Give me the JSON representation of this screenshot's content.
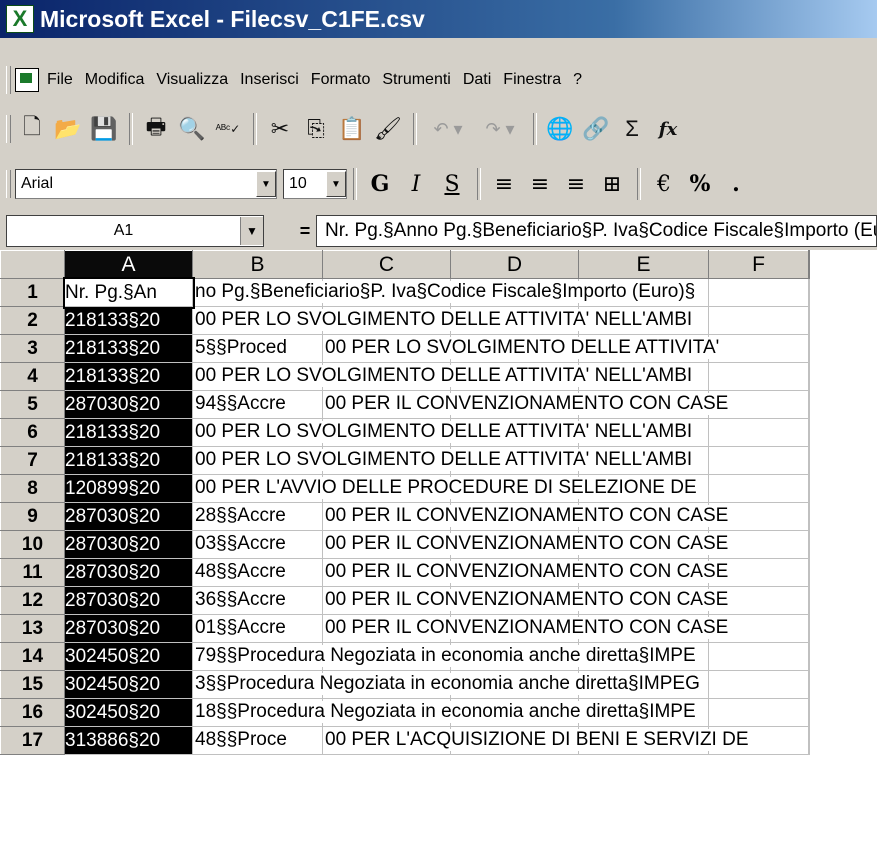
{
  "window": {
    "title": "Microsoft Excel - Filecsv_C1FE.csv",
    "app_icon": "excel-icon"
  },
  "menu": [
    {
      "label": "File"
    },
    {
      "label": "Modifica"
    },
    {
      "label": "Visualizza"
    },
    {
      "label": "Inserisci"
    },
    {
      "label": "Formato"
    },
    {
      "label": "Strumenti"
    },
    {
      "label": "Dati"
    },
    {
      "label": "Finestra"
    },
    {
      "label": "?"
    }
  ],
  "toolbar": {
    "new": "🗋",
    "open": "📂",
    "save": "💾",
    "print": "🖶",
    "preview": "🔍",
    "spell": "ᴬᴮᶜ✓",
    "cut": "✂",
    "copy": "⎘",
    "paste": "📋",
    "format_painter": "🖌",
    "undo": "↶ ▾",
    "redo": "↷ ▾",
    "web": "🌐",
    "hyperlink": "🔗",
    "autosum": "Σ",
    "function": "fx"
  },
  "format": {
    "font": "Arial",
    "size": "10",
    "bold": "G",
    "italic": "I",
    "underline": "S",
    "align_left": "≡",
    "align_center": "≡",
    "align_right": "≡",
    "merge": "⊞",
    "currency": "€",
    "percent": "%",
    "thousands": "."
  },
  "formula_bar": {
    "name_box": "A1",
    "equals": "=",
    "content": "Nr. Pg.§Anno Pg.§Beneficiario§P. Iva§Codice Fiscale§Importo (Euro)§"
  },
  "columns": [
    "A",
    "B",
    "C",
    "D",
    "E",
    "F"
  ],
  "rows": [
    {
      "num": "1",
      "a": "Nr. Pg.§An",
      "b": "no Pg.§Beneficiario§P. Iva§Codice Fiscale§Importo (Euro)§"
    },
    {
      "num": "2",
      "a": "218133§20",
      "b": "00 PER LO SVOLGIMENTO DELLE ATTIVITA' NELL'AMBI"
    },
    {
      "num": "3",
      "a": "218133§20",
      "b": "5§§Proced",
      "c": "00 PER LO SVOLGIMENTO DELLE ATTIVITA'"
    },
    {
      "num": "4",
      "a": "218133§20",
      "b": "00 PER LO SVOLGIMENTO DELLE ATTIVITA' NELL'AMBI"
    },
    {
      "num": "5",
      "a": "287030§20",
      "b": "94§§Accre",
      "c": "00 PER IL CONVENZIONAMENTO CON CASE"
    },
    {
      "num": "6",
      "a": "218133§20",
      "b": "00 PER LO SVOLGIMENTO DELLE ATTIVITA' NELL'AMBI"
    },
    {
      "num": "7",
      "a": "218133§20",
      "b": "00 PER LO SVOLGIMENTO DELLE ATTIVITA' NELL'AMBI"
    },
    {
      "num": "8",
      "a": "120899§20",
      "b": "00 PER L'AVVIO DELLE PROCEDURE DI SELEZIONE DE"
    },
    {
      "num": "9",
      "a": "287030§20",
      "b": "28§§Accre",
      "c": "00 PER IL CONVENZIONAMENTO CON CASE"
    },
    {
      "num": "10",
      "a": "287030§20",
      "b": "03§§Accre",
      "c": "00 PER IL CONVENZIONAMENTO CON CASE"
    },
    {
      "num": "11",
      "a": "287030§20",
      "b": "48§§Accre",
      "c": "00 PER IL CONVENZIONAMENTO CON CASE"
    },
    {
      "num": "12",
      "a": "287030§20",
      "b": "36§§Accre",
      "c": "00 PER IL CONVENZIONAMENTO CON CASE"
    },
    {
      "num": "13",
      "a": "287030§20",
      "b": "01§§Accre",
      "c": "00 PER IL CONVENZIONAMENTO CON CASE"
    },
    {
      "num": "14",
      "a": "302450§20",
      "b": "79§§Procedura Negoziata in economia anche diretta§IMPE"
    },
    {
      "num": "15",
      "a": "302450§20",
      "b": "3§§Procedura Negoziata in economia anche diretta§IMPEG"
    },
    {
      "num": "16",
      "a": "302450§20",
      "b": "18§§Procedura Negoziata in economia anche diretta§IMPE"
    },
    {
      "num": "17",
      "a": "313886§20",
      "b": "48§§Proce",
      "c": "00 PER L'ACQUISIZIONE DI BENI E SERVIZI DE"
    }
  ]
}
